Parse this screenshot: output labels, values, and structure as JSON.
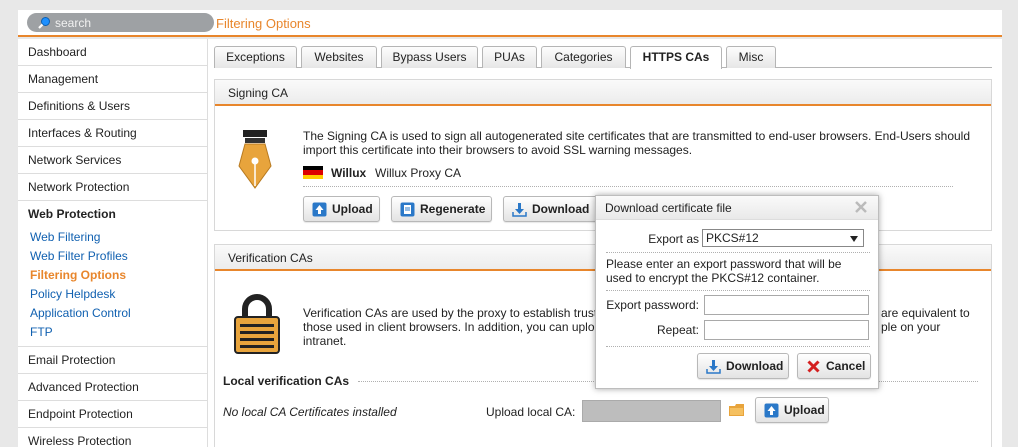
{
  "search": {
    "placeholder": "search"
  },
  "header": {
    "title": "Filtering Options"
  },
  "sidebar": {
    "items": [
      "Dashboard",
      "Management",
      "Definitions & Users",
      "Interfaces & Routing",
      "Network Services",
      "Network Protection",
      "Web Protection"
    ],
    "web_protection_sub": [
      "Web Filtering",
      "Web Filter Profiles",
      "Filtering Options",
      "Policy Helpdesk",
      "Application Control",
      "FTP"
    ],
    "items_after": [
      "Email Protection",
      "Advanced Protection",
      "Endpoint Protection",
      "Wireless Protection"
    ]
  },
  "tabs": [
    "Exceptions",
    "Websites",
    "Bypass Users",
    "PUAs",
    "Categories",
    "HTTPS CAs",
    "Misc"
  ],
  "signing": {
    "title": "Signing CA",
    "description": "The Signing CA is used to sign all autogenerated site certificates that are transmitted to end-user browsers. End-Users should import this certificate into their browsers to avoid SSL warning messages.",
    "ca_org": "Willux",
    "ca_name": "Willux Proxy CA",
    "upload": "Upload",
    "regenerate": "Regenerate",
    "download": "Download"
  },
  "verification": {
    "title": "Verification CAs",
    "desc_line1_a": "Verification CAs are used by the proxy to establish trust",
    "desc_line1_b": "are equivalent to",
    "desc_line2_a": "those used in client browsers. In addition, you can uplo",
    "desc_line2_b": "ple on your",
    "desc_line3": "intranet.",
    "local_title": "Local verification CAs",
    "no_certs": "No local CA Certificates installed",
    "upload_label": "Upload local CA:",
    "upload_button": "Upload"
  },
  "dialog": {
    "title": "Download certificate file",
    "export_as_label": "Export as",
    "export_as_value": "PKCS#12",
    "info": "Please enter an export password that will be used to encrypt the PKCS#12 container.",
    "password_label": "Export password:",
    "repeat_label": "Repeat:",
    "download": "Download",
    "cancel": "Cancel"
  },
  "colors": {
    "accent": "#e8862c",
    "link": "#1060b0"
  }
}
